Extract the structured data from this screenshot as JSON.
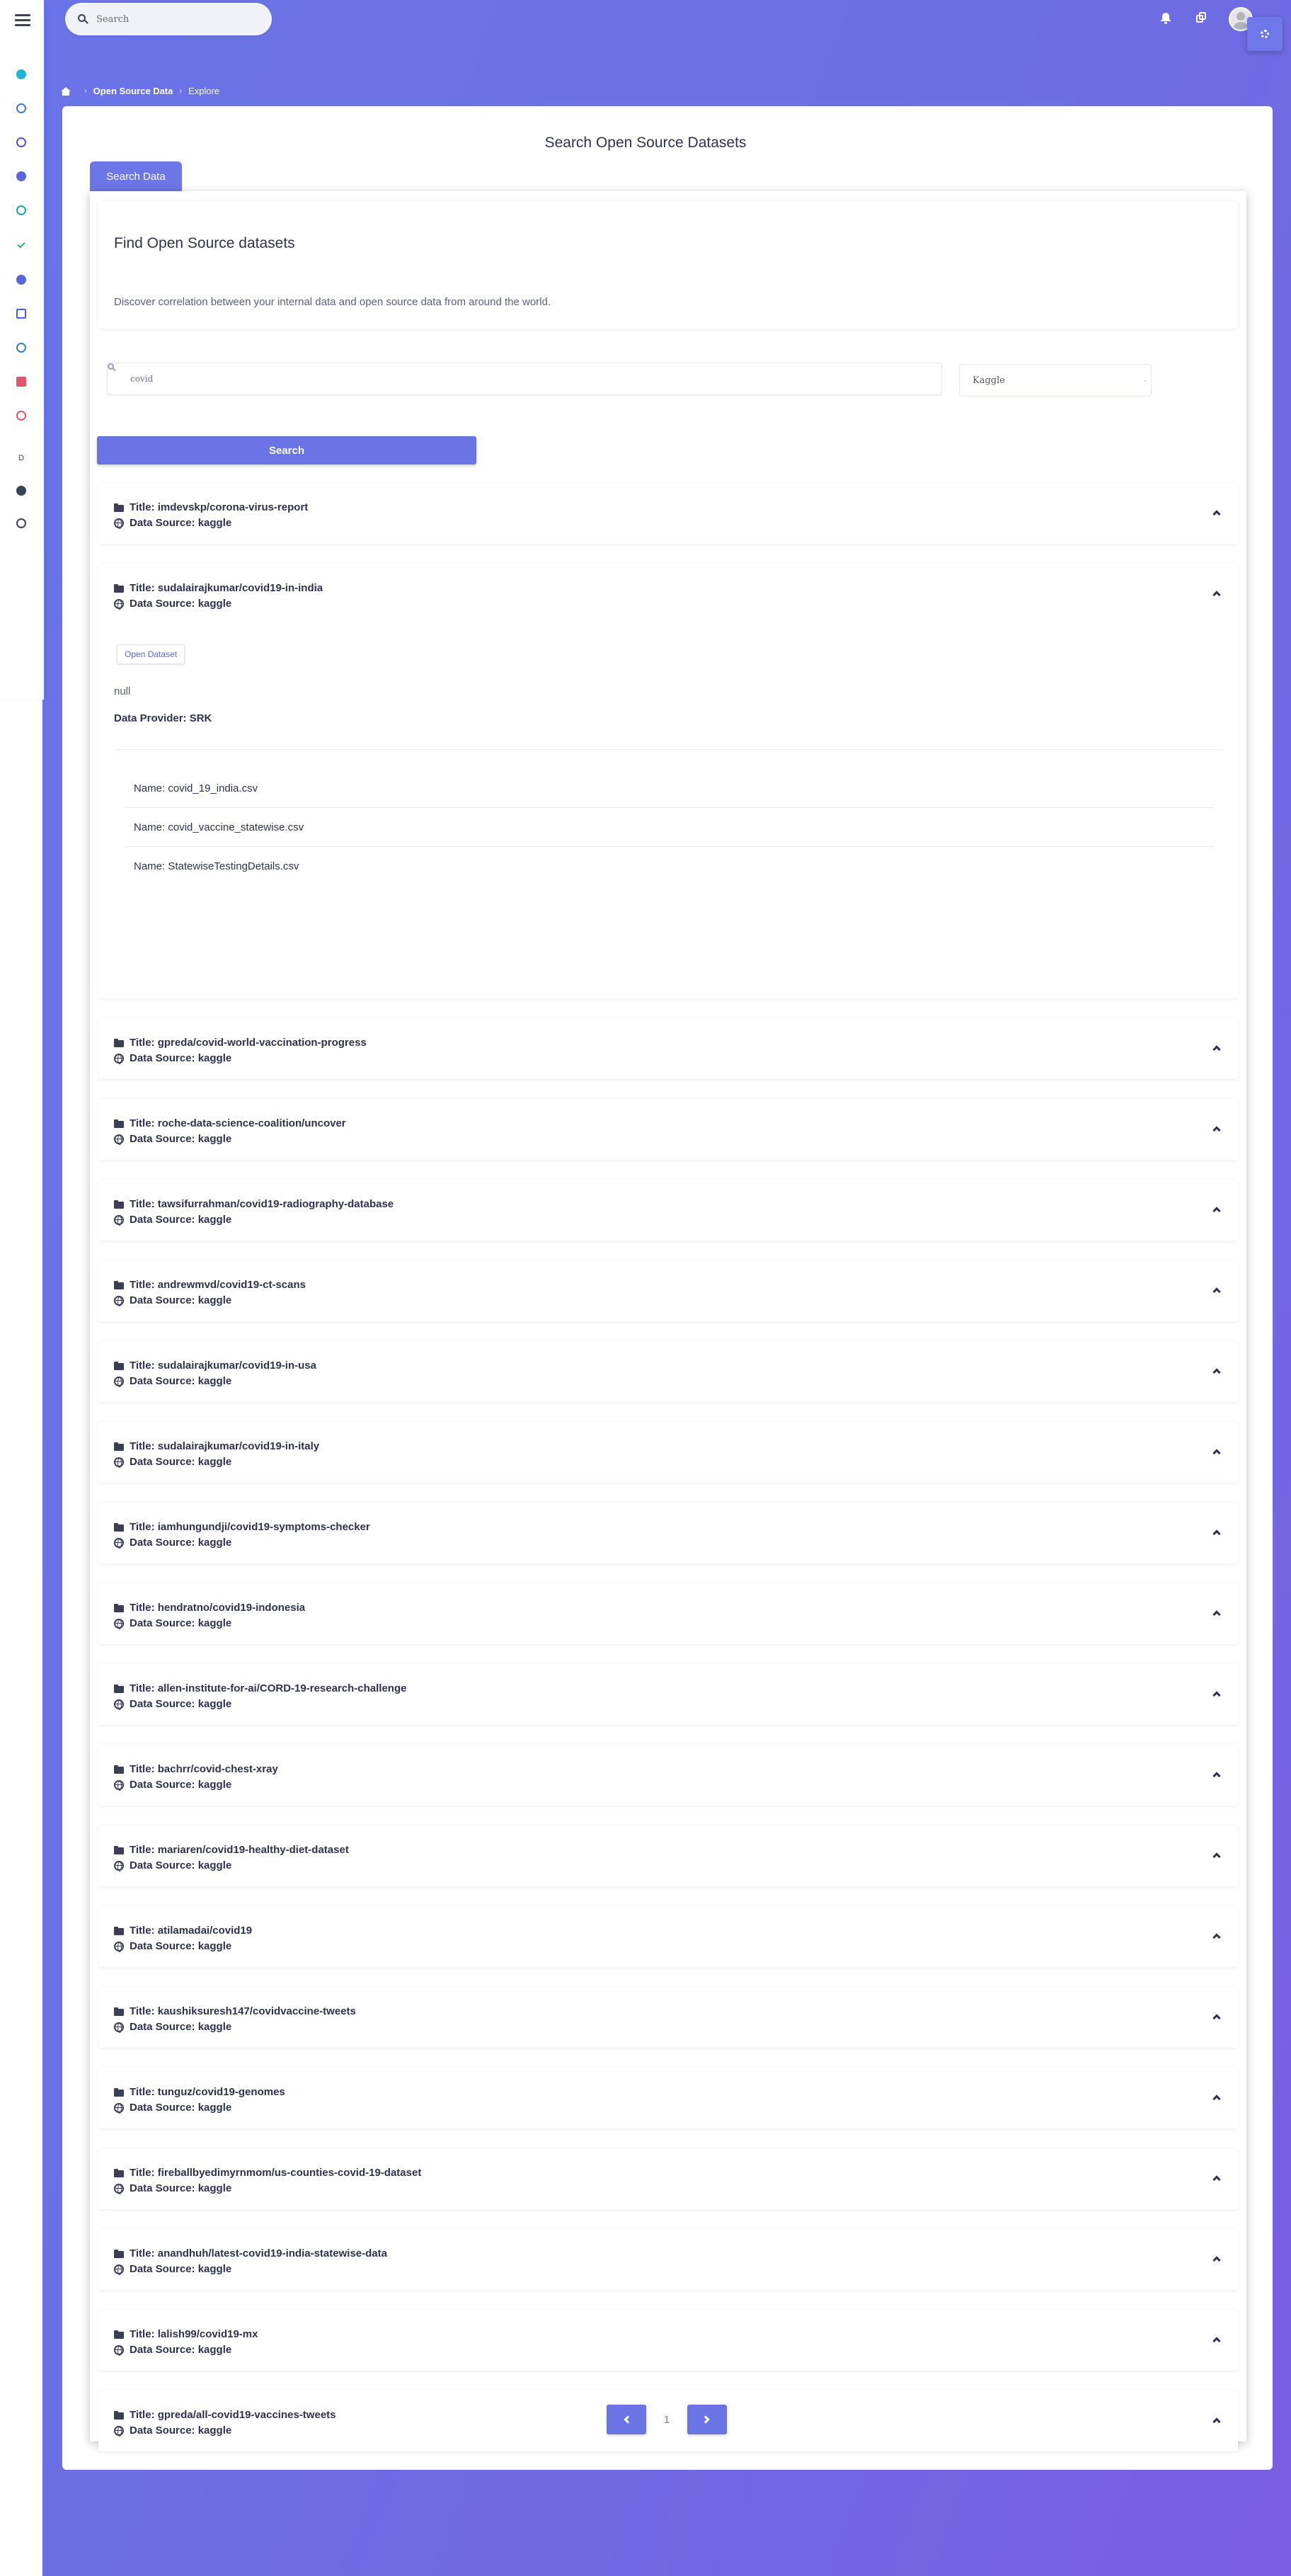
{
  "topbar": {
    "search_placeholder": "Search",
    "dots": "··"
  },
  "breadcrumb": {
    "items": [
      "Open Source Data",
      "Explore"
    ]
  },
  "page": {
    "title": "Search Open Source Datasets",
    "tab_label": "Search Data"
  },
  "intro": {
    "heading": "Find Open Source datasets",
    "description": "Discover correlation between your internal data and open source data from around the world."
  },
  "search": {
    "query_value": "covid",
    "source_selected": "Kaggle",
    "button_label": "Search"
  },
  "labels": {
    "title_prefix": "Title: ",
    "source_prefix": "Data Source: ",
    "open_dataset": "Open Dataset",
    "provider_prefix": "Data Provider: ",
    "file_prefix": "Name: "
  },
  "results": [
    {
      "title": "imdevskp/corona-virus-report",
      "source": "kaggle"
    },
    {
      "title": "sudalairajkumar/covid19-in-india",
      "source": "kaggle",
      "expanded": true,
      "description": "null",
      "provider": "SRK",
      "files": [
        "covid_19_india.csv",
        "covid_vaccine_statewise.csv",
        "StatewiseTestingDetails.csv"
      ]
    },
    {
      "title": "gpreda/covid-world-vaccination-progress",
      "source": "kaggle"
    },
    {
      "title": "roche-data-science-coalition/uncover",
      "source": "kaggle"
    },
    {
      "title": "tawsifurrahman/covid19-radiography-database",
      "source": "kaggle"
    },
    {
      "title": "andrewmvd/covid19-ct-scans",
      "source": "kaggle"
    },
    {
      "title": "sudalairajkumar/covid19-in-usa",
      "source": "kaggle"
    },
    {
      "title": "sudalairajkumar/covid19-in-italy",
      "source": "kaggle"
    },
    {
      "title": "iamhungundji/covid19-symptoms-checker",
      "source": "kaggle"
    },
    {
      "title": "hendratno/covid19-indonesia",
      "source": "kaggle"
    },
    {
      "title": "allen-institute-for-ai/CORD-19-research-challenge",
      "source": "kaggle"
    },
    {
      "title": "bachrr/covid-chest-xray",
      "source": "kaggle"
    },
    {
      "title": "mariaren/covid19-healthy-diet-dataset",
      "source": "kaggle"
    },
    {
      "title": "atilamadai/covid19",
      "source": "kaggle"
    },
    {
      "title": "kaushiksuresh147/covidvaccine-tweets",
      "source": "kaggle"
    },
    {
      "title": "tunguz/covid19-genomes",
      "source": "kaggle"
    },
    {
      "title": "fireballbyedimyrnmom/us-counties-covid-19-dataset",
      "source": "kaggle"
    },
    {
      "title": "anandhuh/latest-covid19-india-statewise-data",
      "source": "kaggle"
    },
    {
      "title": "lalish99/covid19-mx",
      "source": "kaggle"
    },
    {
      "title": "gpreda/all-covid19-vaccines-tweets",
      "source": "kaggle"
    }
  ],
  "pagination": {
    "current_page": "1"
  },
  "colors": {
    "accent": "#6a74e4",
    "gradient_start": "#6a74e6",
    "gradient_end": "#7a5fe0"
  },
  "sidebar_icons": [
    {
      "name": "analytics-icon",
      "color": "#1fb6d6"
    },
    {
      "name": "compass-icon",
      "color": "#3a7bd5"
    },
    {
      "name": "search-data-icon",
      "color": "#5a4fcf"
    },
    {
      "name": "cog-icon",
      "color": "#5a67d8"
    },
    {
      "name": "layers-icon",
      "color": "#1aa7a7"
    },
    {
      "name": "check-icon",
      "color": "#2bb673"
    },
    {
      "name": "settings-icon",
      "color": "#5a67d8"
    },
    {
      "name": "briefcase-icon",
      "color": "#4a5be0"
    },
    {
      "name": "explore-icon",
      "color": "#3a7bd5"
    },
    {
      "name": "calendar-icon",
      "color": "#e0556b"
    },
    {
      "name": "magic-icon",
      "color": "#e0556b"
    },
    {
      "name": "d-icon",
      "color": "#3c4257"
    },
    {
      "name": "music-icon",
      "color": "#3c4257"
    },
    {
      "name": "palette-icon",
      "color": "#3c4257"
    }
  ]
}
